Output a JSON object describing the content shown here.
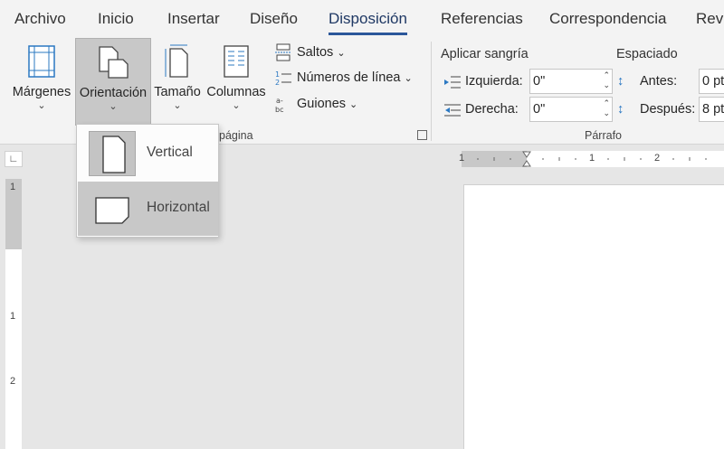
{
  "tabs": [
    "Archivo",
    "Inicio",
    "Insertar",
    "Diseño",
    "Disposición",
    "Referencias",
    "Correspondencia",
    "Revi"
  ],
  "active_tab": "Disposición",
  "accent_color": "#2b579a",
  "page_setup": {
    "margins_label": "Márgenes",
    "orientation_label": "Orientación",
    "size_label": "Tamaño",
    "columns_label": "Columnas",
    "breaks_label": "Saltos",
    "line_numbers_label": "Números de línea",
    "hyphenation_label": "Guiones",
    "group_label_partial": "página",
    "chevron": "⌄"
  },
  "paragraph": {
    "indent_title": "Aplicar sangría",
    "spacing_title": "Espaciado",
    "left_label": "Izquierda:",
    "left_value": "0\"",
    "right_label": "Derecha:",
    "right_value": "0\"",
    "before_label": "Antes:",
    "before_value": "0 pt",
    "after_label": "Después:",
    "after_value": "8 pt",
    "group_label": "Párrafo"
  },
  "orientation_menu": {
    "items": [
      {
        "label": "Vertical",
        "selected": true
      },
      {
        "label": "Horizontal",
        "hovered": true
      }
    ]
  },
  "ruler": {
    "h_numbers": [
      "1",
      "1",
      "2"
    ],
    "v_numbers": [
      "1",
      "1",
      "2"
    ]
  }
}
